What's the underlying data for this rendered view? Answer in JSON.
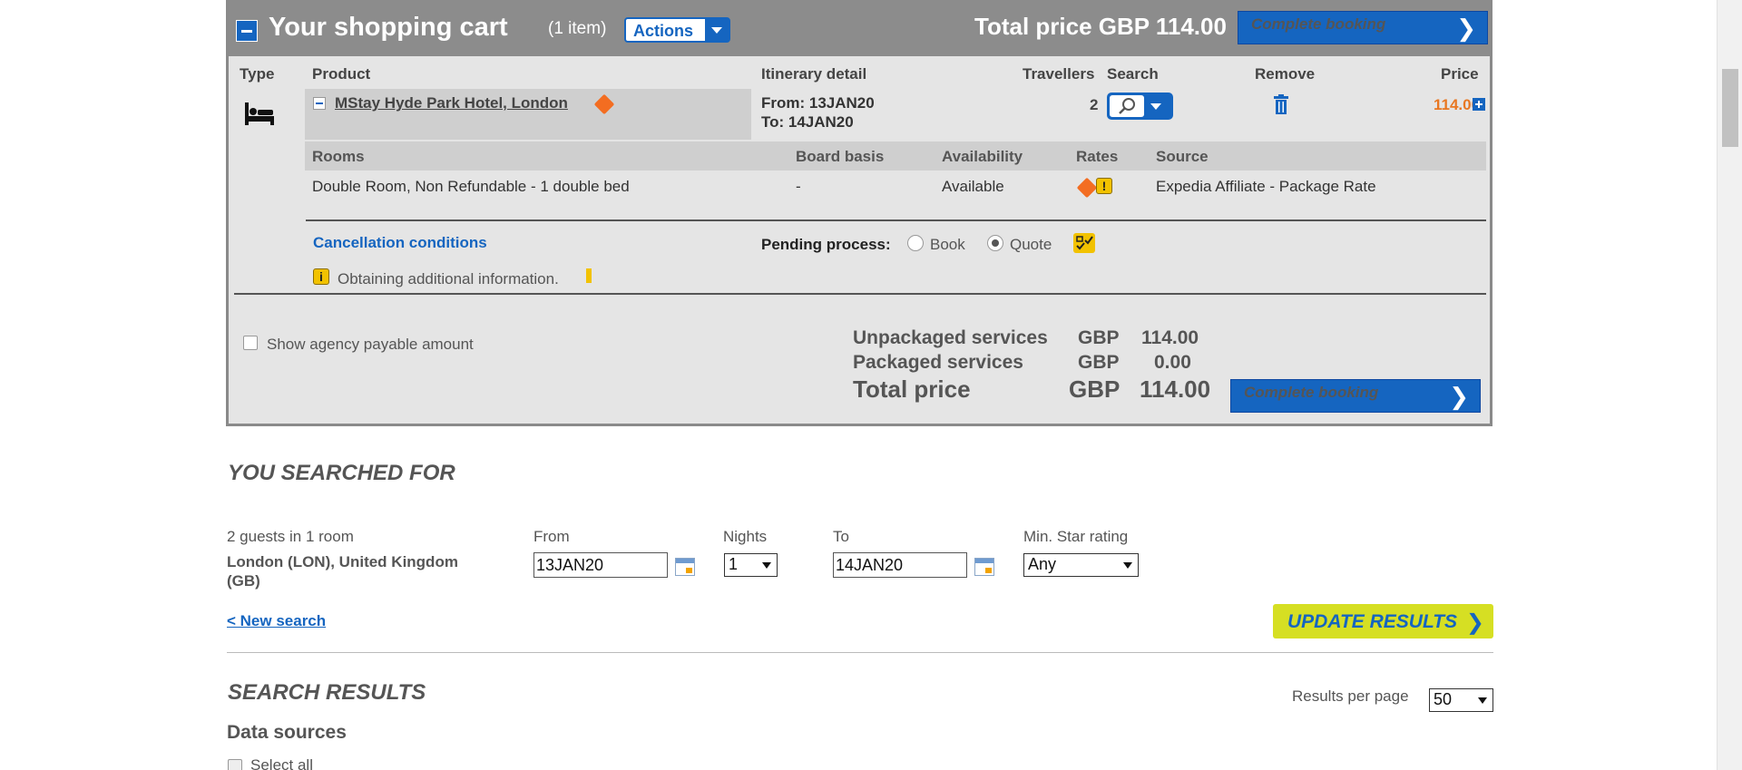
{
  "cart": {
    "title": "Your shopping cart",
    "item_count": "(1 item)",
    "actions_label": "Actions",
    "total_header": "Total price GBP 114.00",
    "complete_label": "Complete booking",
    "columns": {
      "type": "Type",
      "product": "Product",
      "itinerary": "Itinerary detail",
      "travellers": "Travellers",
      "search": "Search",
      "remove": "Remove",
      "price": "Price"
    },
    "item": {
      "hotel_name": "MStay Hyde Park Hotel, London",
      "from": "From: 13JAN20",
      "to": "To: 14JAN20",
      "travellers": "2",
      "price": "114.00"
    },
    "room_columns": {
      "rooms": "Rooms",
      "board": "Board basis",
      "availability": "Availability",
      "rates": "Rates",
      "source": "Source"
    },
    "room": {
      "name": "Double Room, Non Refundable - 1 double bed",
      "board": "-",
      "availability": "Available",
      "source": "Expedia Affiliate - Package Rate"
    },
    "cancellation_link": "Cancellation conditions",
    "pending_label": "Pending process:",
    "pending_options": [
      "Book",
      "Quote"
    ],
    "pending_selected": "Quote",
    "info_text": "Obtaining additional information.",
    "agency_label": "Show agency payable amount",
    "summary": {
      "unpackaged_label": "Unpackaged services",
      "unpackaged_currency": "GBP",
      "unpackaged_amount": "114.00",
      "packaged_label": "Packaged services",
      "packaged_currency": "GBP",
      "packaged_amount": "0.00",
      "total_label": "Total price",
      "total_currency": "GBP",
      "total_amount": "114.00"
    }
  },
  "search": {
    "title": "YOU SEARCHED FOR",
    "guests": "2 guests in 1 room",
    "destination": "London (LON), United Kingdom (GB)",
    "from_label": "From",
    "from_value": "13JAN20",
    "nights_label": "Nights",
    "nights_value": "1",
    "to_label": "To",
    "to_value": "14JAN20",
    "star_label": "Min. Star rating",
    "star_value": "Any",
    "new_search": "< New search",
    "update_label": "UPDATE RESULTS"
  },
  "results": {
    "title": "SEARCH RESULTS",
    "per_page_label": "Results per page",
    "per_page_value": "50",
    "data_sources": "Data sources",
    "select_all": "Select all"
  },
  "colors": {
    "brand_blue": "#1565c0",
    "header_gray": "#8c8c8c",
    "price_orange": "#e87722",
    "update_yellow": "#d6df23"
  },
  "icons": [
    "bed-icon",
    "tag-icon",
    "search-icon",
    "trash-icon",
    "plus-icon",
    "warning-icon",
    "info-icon",
    "checklist-icon",
    "calendar-icon",
    "chevron-right-icon"
  ]
}
